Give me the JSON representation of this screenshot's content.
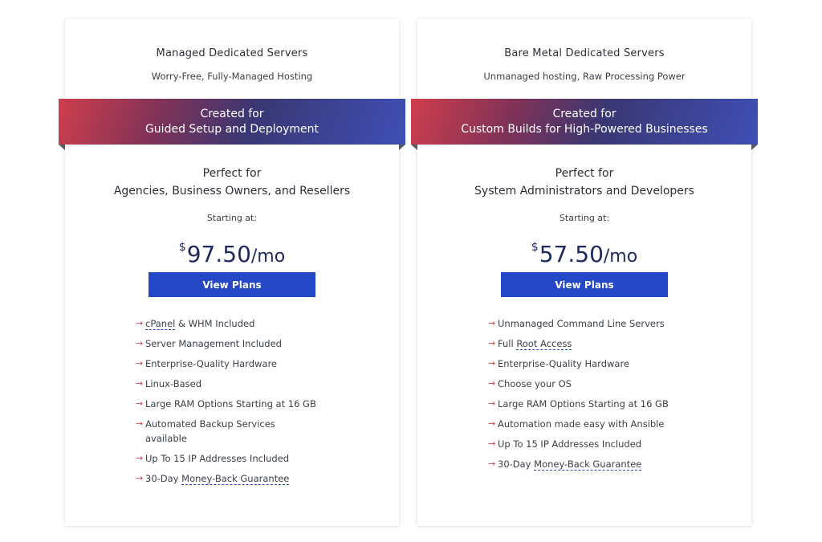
{
  "plans": [
    {
      "title": "Managed Dedicated Servers",
      "subtitle": "Worry-Free, Fully-Managed Hosting",
      "ribbon_line1": "Created for",
      "ribbon_line2": "Guided Setup and Deployment",
      "perfect_line1": "Perfect for",
      "perfect_line2": "Agencies, Business Owners, and Resellers",
      "starting_label": "Starting at:",
      "currency": "$",
      "amount": "97.50",
      "period": "/mo",
      "button_label": "View Plans",
      "features": [
        {
          "pre": "",
          "link": "cPanel",
          "post": " & WHM Included"
        },
        {
          "pre": "Server Management Included",
          "link": "",
          "post": ""
        },
        {
          "pre": "Enterprise-Quality Hardware",
          "link": "",
          "post": ""
        },
        {
          "pre": "Linux-Based",
          "link": "",
          "post": ""
        },
        {
          "pre": "Large RAM Options Starting at 16 GB",
          "link": "",
          "post": ""
        },
        {
          "pre": "Automated Backup Services available",
          "link": "",
          "post": ""
        },
        {
          "pre": "Up To 15 IP Addresses Included",
          "link": "",
          "post": ""
        },
        {
          "pre": "30-Day ",
          "link": "Money-Back Guarantee",
          "post": ""
        }
      ]
    },
    {
      "title": "Bare Metal Dedicated Servers",
      "subtitle": "Unmanaged hosting, Raw Processing Power",
      "ribbon_line1": "Created for",
      "ribbon_line2": "Custom Builds for High-Powered Businesses",
      "perfect_line1": "Perfect for",
      "perfect_line2": "System Administrators and Developers",
      "starting_label": "Starting at:",
      "currency": "$",
      "amount": "57.50",
      "period": "/mo",
      "button_label": "View Plans",
      "features": [
        {
          "pre": "Unmanaged Command Line Servers",
          "link": "",
          "post": ""
        },
        {
          "pre": "Full ",
          "link": "Root Access",
          "post": ""
        },
        {
          "pre": "Enterprise-Quality Hardware",
          "link": "",
          "post": ""
        },
        {
          "pre": "Choose your OS",
          "link": "",
          "post": ""
        },
        {
          "pre": "Large RAM Options Starting at 16 GB",
          "link": "",
          "post": ""
        },
        {
          "pre": "Automation made easy with Ansible",
          "link": "",
          "post": ""
        },
        {
          "pre": "Up To 15 IP Addresses Included",
          "link": "",
          "post": ""
        },
        {
          "pre": "30-Day ",
          "link": "Money-Back Guarantee",
          "post": ""
        }
      ]
    }
  ],
  "colors": {
    "button": "#2447c6",
    "price": "#1e2a5e",
    "arrow": "#d64550",
    "ribbon_start": "#cf3e4d",
    "ribbon_end": "#3f4fb6"
  },
  "icons": {
    "feature_bullet": "arrow-right-icon"
  }
}
